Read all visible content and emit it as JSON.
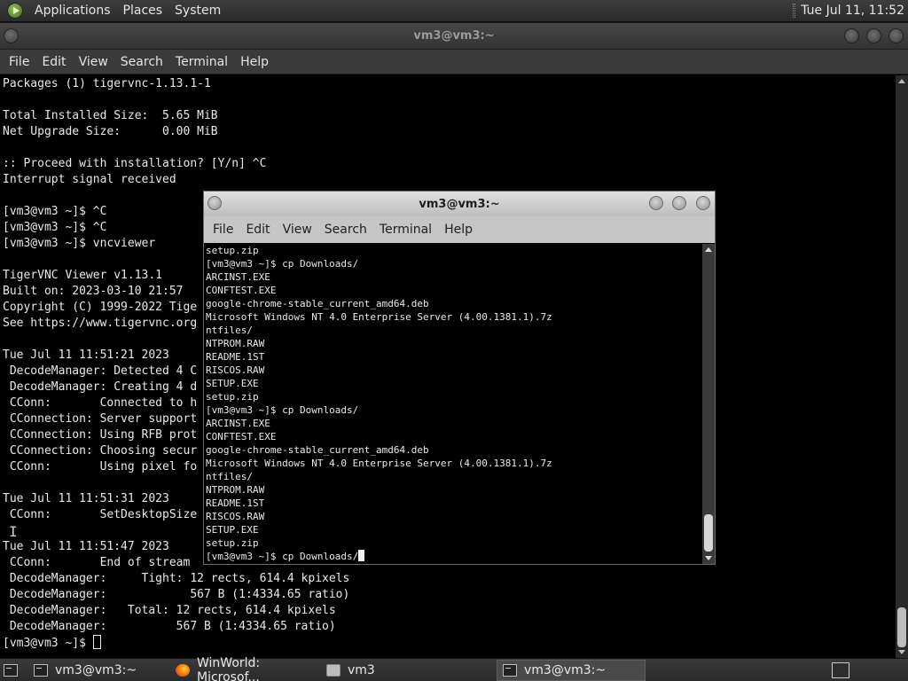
{
  "top_panel": {
    "menus": [
      "Applications",
      "Places",
      "System"
    ],
    "clock": "Tue Jul 11, 11:52"
  },
  "main_window": {
    "title": "vm3@vm3:~",
    "menus": [
      "File",
      "Edit",
      "View",
      "Search",
      "Terminal",
      "Help"
    ],
    "lines": [
      "Packages (1) tigervnc-1.13.1-1",
      "",
      "Total Installed Size:  5.65 MiB",
      "Net Upgrade Size:      0.00 MiB",
      "",
      ":: Proceed with installation? [Y/n] ^C",
      "Interrupt signal received",
      "",
      "[vm3@vm3 ~]$ ^C",
      "[vm3@vm3 ~]$ ^C",
      "[vm3@vm3 ~]$ vncviewer",
      "",
      "TigerVNC Viewer v1.13.1",
      "Built on: 2023-03-10 21:57",
      "Copyright (C) 1999-2022 Tige",
      "See https://www.tigervnc.org",
      "",
      "Tue Jul 11 11:51:21 2023",
      " DecodeManager: Detected 4 C",
      " DecodeManager: Creating 4 d",
      " CConn:       Connected to h",
      " CConnection: Server support",
      " CConnection: Using RFB prot",
      " CConnection: Choosing secur",
      " CConn:       Using pixel fo",
      "",
      "Tue Jul 11 11:51:31 2023",
      " CConn:       SetDesktopSize",
      "",
      "Tue Jul 11 11:51:47 2023",
      " CConn:       End of stream",
      " DecodeManager:     Tight: 12 rects, 614.4 kpixels",
      " DecodeManager:            567 B (1:4334.65 ratio)",
      " DecodeManager:   Total: 12 rects, 614.4 kpixels",
      " DecodeManager:          567 B (1:4334.65 ratio)"
    ],
    "prompt": "[vm3@vm3 ~]$ "
  },
  "inner_window": {
    "title": "vm3@vm3:~",
    "menus": [
      "File",
      "Edit",
      "View",
      "Search",
      "Terminal",
      "Help"
    ],
    "lines": [
      "setup.zip",
      "[vm3@vm3 ~]$ cp Downloads/",
      "ARCINST.EXE",
      "CONFTEST.EXE",
      "google-chrome-stable_current_amd64.deb",
      "Microsoft Windows NT 4.0 Enterprise Server (4.00.1381.1).7z",
      "ntfiles/",
      "NTPROM.RAW",
      "README.1ST",
      "RISCOS.RAW",
      "SETUP.EXE",
      "setup.zip",
      "[vm3@vm3 ~]$ cp Downloads/",
      "ARCINST.EXE",
      "CONFTEST.EXE",
      "google-chrome-stable_current_amd64.deb",
      "Microsoft Windows NT 4.0 Enterprise Server (4.00.1381.1).7z",
      "ntfiles/",
      "NTPROM.RAW",
      "README.1ST",
      "RISCOS.RAW",
      "SETUP.EXE",
      "setup.zip"
    ],
    "prompt": "[vm3@vm3 ~]$ cp Downloads/"
  },
  "taskbar": {
    "tasks": [
      {
        "label": "vm3@vm3:~",
        "icon": "terminal-icon"
      },
      {
        "label": "WinWorld: Microsof...",
        "icon": "firefox-icon"
      },
      {
        "label": "vm3",
        "icon": "folder-icon"
      },
      {
        "label": "vm3@vm3:~",
        "icon": "terminal-icon",
        "active": true
      }
    ]
  }
}
